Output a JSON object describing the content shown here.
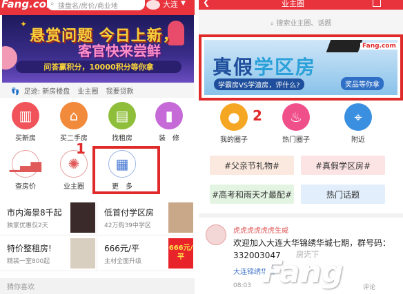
{
  "left": {
    "logo": "Fang.com",
    "search_placeholder": "搜盘名/房价/商业地",
    "city": "大连",
    "banner": {
      "line1": "悬赏问题 今日上新，",
      "line2": "客官快来尝鲜",
      "line3": "问答赢积分，10000积分等你拿"
    },
    "footprint_label": "足迹:",
    "footprint_links": [
      "新房楼盘",
      "业主圈",
      "我要贷款"
    ],
    "grid": [
      {
        "label": "买新房",
        "icon": "building-icon",
        "color": "#f0545a"
      },
      {
        "label": "买二手房",
        "icon": "house-icon",
        "color": "#f28a3c"
      },
      {
        "label": "找租房",
        "icon": "briefcase-icon",
        "color": "#8fbf3a"
      },
      {
        "label": "装　修",
        "icon": "paint-roller-icon",
        "color": "#c56ad6"
      },
      {
        "label": "查房价",
        "icon": "chart-icon",
        "color": "#e05a5a"
      },
      {
        "label": "业主圈",
        "icon": "aperture-icon",
        "color": "#e05a5a"
      },
      {
        "label": "更　多",
        "icon": "more-grid-icon",
        "color": "#3b6fd0"
      }
    ],
    "annotation_number": "1",
    "tiles": [
      {
        "title": "市内海景8千起",
        "sub": "独家优惠仅2天"
      },
      {
        "title": "低首付学区房",
        "sub": "42万购39中学区"
      },
      {
        "title": "特价整租房!",
        "sub": "精装一室800起"
      },
      {
        "title": "666元/平",
        "sub": "主材全面升级",
        "badge": "666元/平"
      }
    ],
    "footer_text": "猜你喜欢"
  },
  "right": {
    "title": "业主圈",
    "search_placeholder": "搜索业主圈、话题",
    "banner": {
      "main_a": "真假",
      "main_b": "学区房",
      "sub": "学霸房VS学渣房，评什么?",
      "button": "奖品等你拿",
      "brand": "Fang.com"
    },
    "annotation_number": "2",
    "cats": [
      {
        "label": "我的圈子",
        "icon": "person-icon",
        "color": "#f5a623"
      },
      {
        "label": "热门圈子",
        "icon": "flame-icon",
        "color": "#f0508a"
      },
      {
        "label": "附近",
        "icon": "location-pin-icon",
        "color": "#3b8fe0"
      }
    ],
    "tags": [
      {
        "label": "#父亲节礼物#",
        "bg": "#fbe9df"
      },
      {
        "label": "#真假学区房#",
        "bg": "#fce4e4"
      },
      {
        "label": "#高考和雨天才最配#",
        "bg": "#e4f4e2"
      },
      {
        "label": "热门话题",
        "bg": "#e2eefb"
      }
    ],
    "post": {
      "user": "虎虎虎虎虎虎生威",
      "text": "欢迎加入大连大华锦绣华城七期，群号码：332003047",
      "group": "大连锦绣华城",
      "time": "08:03",
      "action": "评论"
    }
  },
  "watermark": "Fang",
  "watermark_small": "房天下"
}
